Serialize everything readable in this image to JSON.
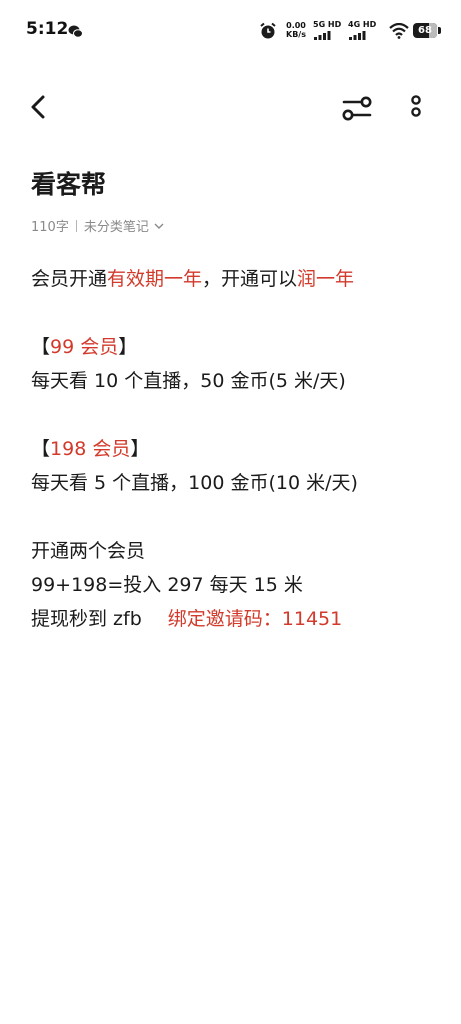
{
  "status_bar": {
    "time": "5:12",
    "speed_value": "0.00",
    "speed_unit": "KB/s",
    "net1": "5G HD",
    "net2": "4G HD",
    "battery": "68",
    "battery_level_percent": 68
  },
  "note": {
    "title": "看客帮",
    "char_count": "110字",
    "category": "未分类笔记"
  },
  "body": {
    "l1_a": "会员开通",
    "l1_b": "有效期一年",
    "l1_c": "，开通可以",
    "l1_d": "润一年",
    "m99_open": "【",
    "m99_title": "99 会员",
    "m99_close": "】",
    "m99_desc": "每天看 10 个直播，50 金币(5 米/天)",
    "m198_open": "【",
    "m198_title": "198 会员",
    "m198_close": "】",
    "m198_desc": "每天看 5 个直播，100 金币(10 米/天)",
    "open_both": "开通两个会员",
    "invest": "99+198=投入 297 每天 15 米",
    "withdraw": "提现秒到 zfb",
    "invite": "绑定邀请码：11451"
  },
  "colors": {
    "accent_red": "#d23a2b",
    "text": "#1b1b1b",
    "meta_gray": "#8a8a8a"
  },
  "icons": [
    "wechat-icon",
    "alarm-icon",
    "wifi-icon",
    "battery-icon",
    "back-arrow-icon",
    "filter-icon",
    "more-vertical-icon",
    "chevron-down-icon"
  ]
}
